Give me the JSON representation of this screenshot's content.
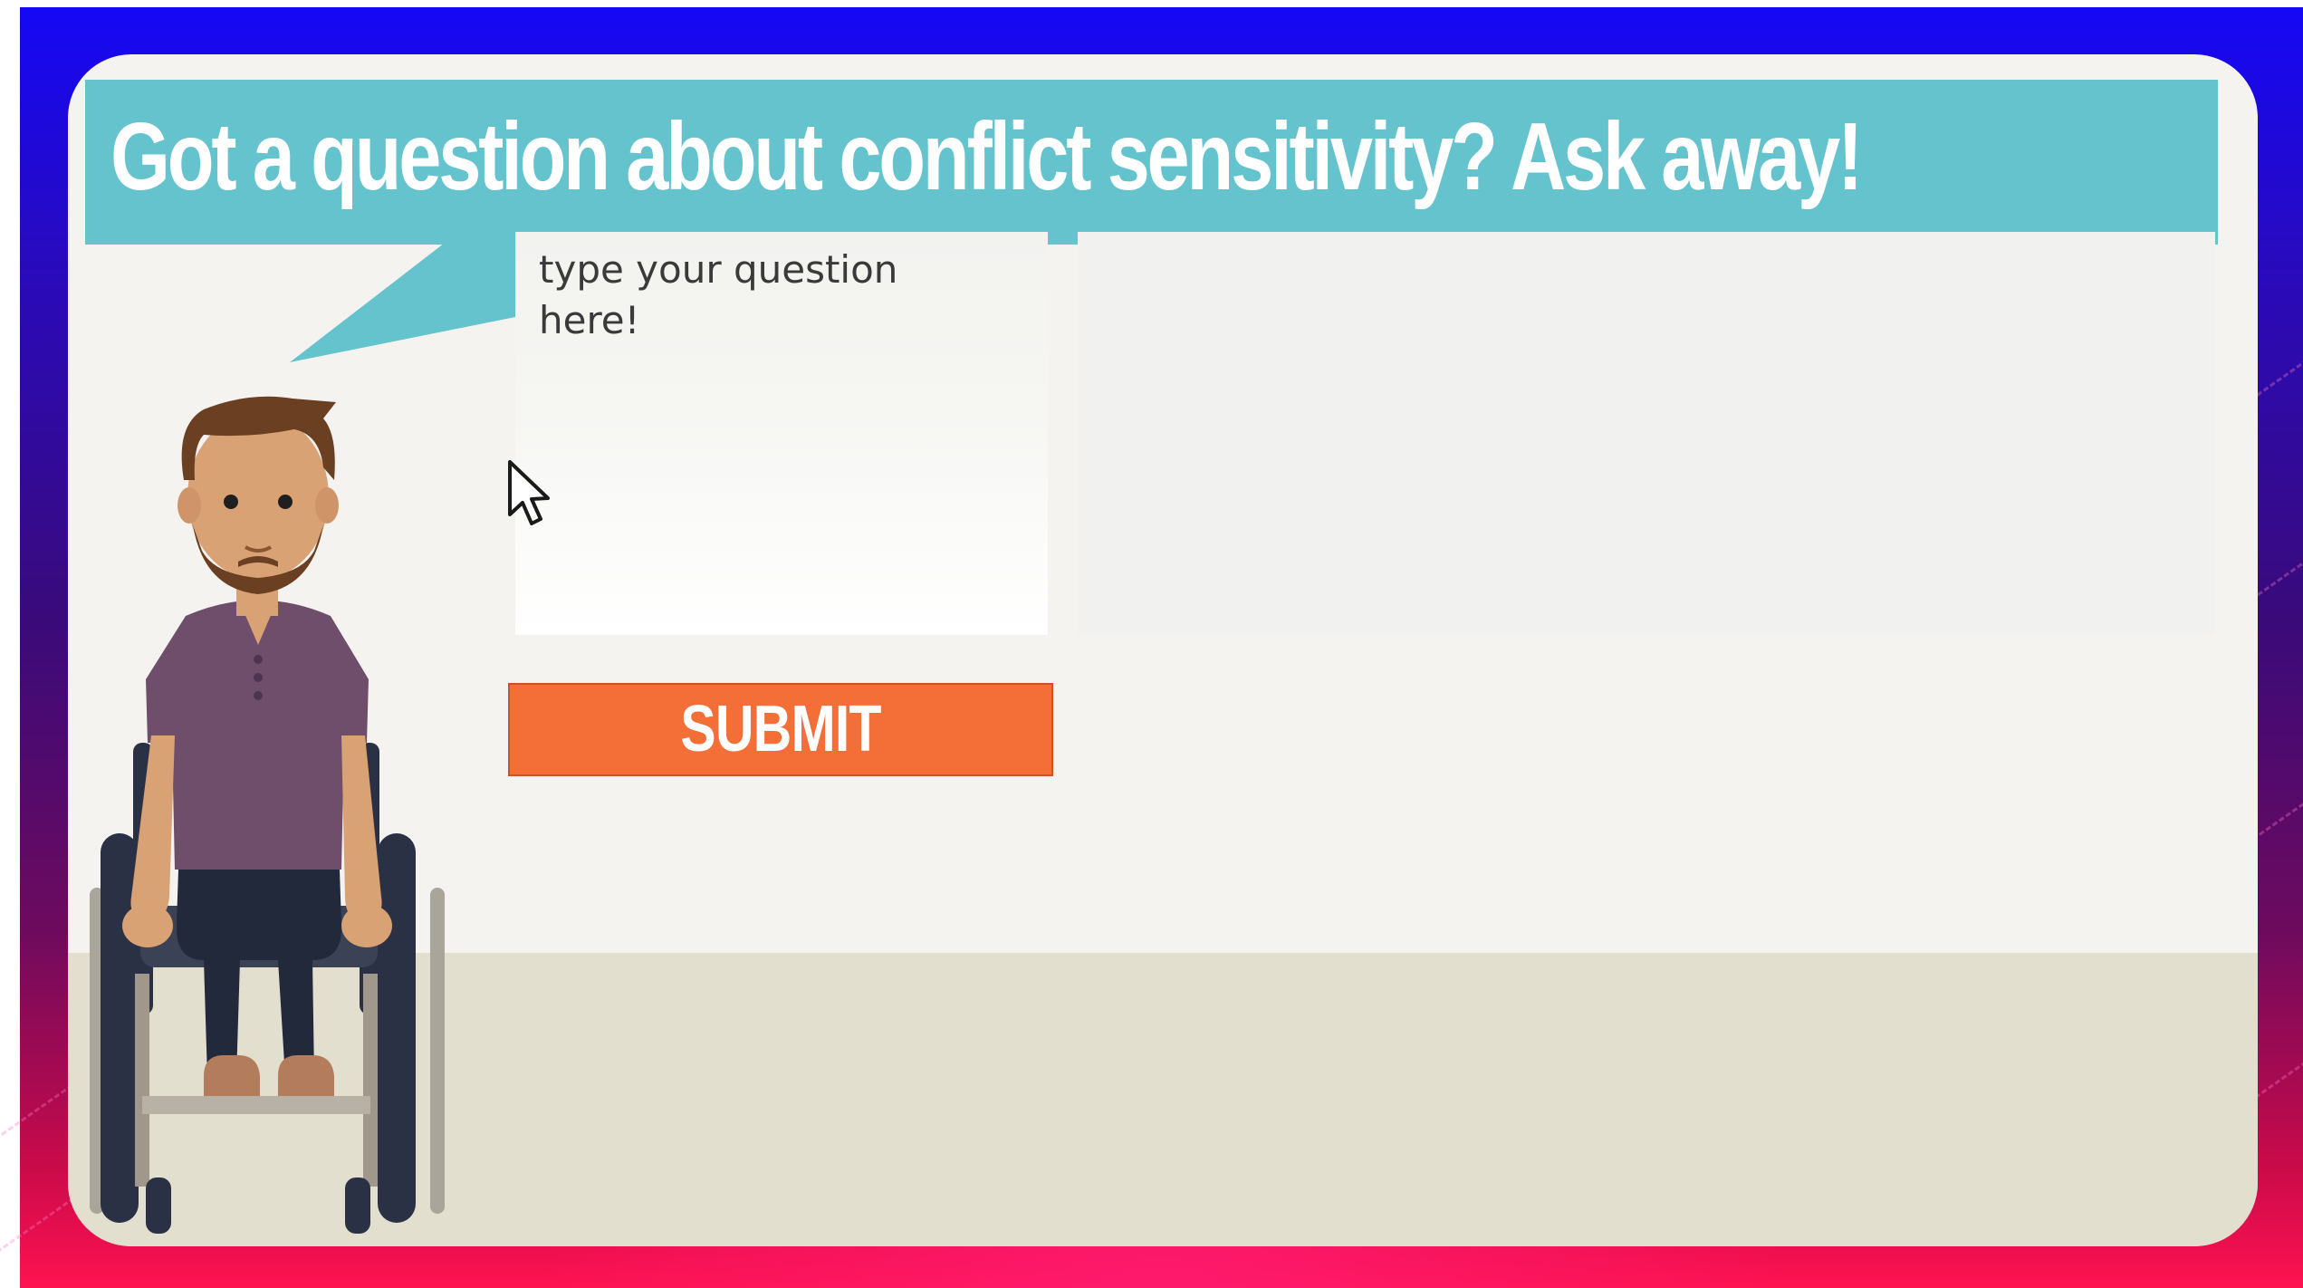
{
  "banner": {
    "title": "Got a question about conflict sensitivity? Ask away!"
  },
  "question": {
    "placeholder": "type your question\nhere!",
    "value": ""
  },
  "answer": {
    "text": ""
  },
  "submit": {
    "label": "SUBMIT"
  },
  "colors": {
    "banner": "#64c3cd",
    "submit": "#f46f38",
    "card": "#f5f3f0",
    "floor": "#e2dfcf",
    "backdrop_top": "#1508f5",
    "backdrop_bottom": "#ff1250"
  },
  "icons": {
    "cursor": "mouse-pointer-icon",
    "character": "wheelchair-user-illustration"
  }
}
